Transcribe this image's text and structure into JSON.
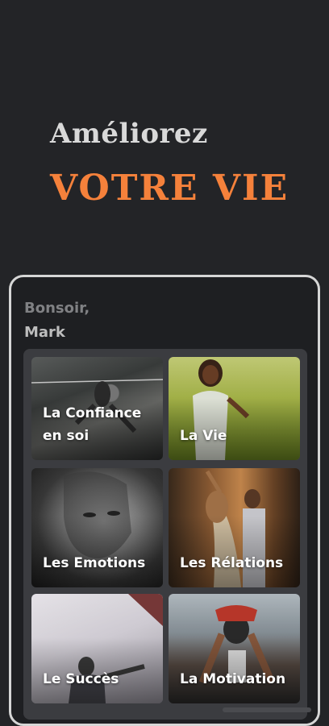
{
  "hero": {
    "line1": "Améliorez",
    "line2": "VOTRE VIE"
  },
  "app": {
    "greeting": "Bonsoir,",
    "user_name": "Mark"
  },
  "categories": [
    {
      "label": "La Confiance\nen soi",
      "image": "tightrope-walker-photo"
    },
    {
      "label": "La Vie",
      "image": "woman-in-field-photo"
    },
    {
      "label": "Les Emotions",
      "image": "crying-woman-photo"
    },
    {
      "label": "Les Rélations",
      "image": "dancing-couple-photo"
    },
    {
      "label": "Le Succès",
      "image": "climber-success-photo"
    },
    {
      "label": "La Motivation",
      "image": "sprinter-start-photo"
    }
  ],
  "colors": {
    "background": "#232427",
    "accent": "#f5813b",
    "panel": "#3b3c40"
  }
}
